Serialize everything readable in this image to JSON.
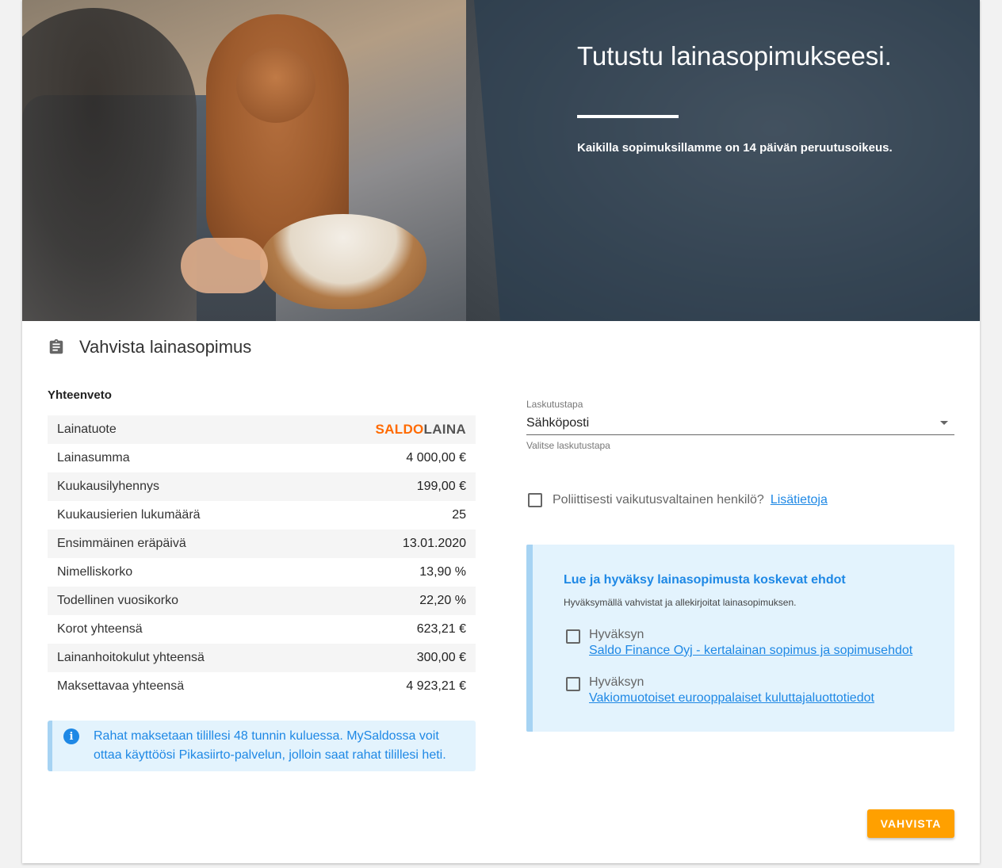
{
  "hero": {
    "title": "Tutustu lainasopimukseesi.",
    "subtitle": "Kaikilla sopimuksillamme on 14 päivän peruutusoikeus."
  },
  "section": {
    "title": "Vahvista lainasopimus",
    "icon": "clipboard-icon"
  },
  "summary": {
    "heading": "Yhteenveto",
    "logo": {
      "part1": "SALDO",
      "part2": "LAINA",
      "color1": "#ff6a00",
      "color2": "#555555"
    },
    "rows": [
      {
        "label": "Lainatuote",
        "value": ""
      },
      {
        "label": "Lainasumma",
        "value": "4 000,00 €"
      },
      {
        "label": "Kuukausilyhennys",
        "value": "199,00 €"
      },
      {
        "label": "Kuukausierien lukumäärä",
        "value": "25"
      },
      {
        "label": "Ensimmäinen eräpäivä",
        "value": "13.01.2020"
      },
      {
        "label": "Nimelliskorko",
        "value": "13,90 %"
      },
      {
        "label": "Todellinen vuosikorko",
        "value": "22,20 %"
      },
      {
        "label": "Korot yhteensä",
        "value": "623,21 €"
      },
      {
        "label": "Lainanhoitokulut yhteensä",
        "value": "300,00 €"
      },
      {
        "label": "Maksettavaa yhteensä",
        "value": "4 923,21 €"
      }
    ]
  },
  "info": {
    "icon": "info-icon",
    "text": "Rahat maksetaan tilillesi 48 tunnin kuluessa. MySaldossa voit ottaa käyttöösi Pikasiirto-palvelun, jolloin saat rahat tilillesi heti."
  },
  "billing": {
    "label": "Laskutustapa",
    "value": "Sähköposti",
    "helper": "Valitse laskutustapa"
  },
  "pep": {
    "question": "Poliittisesti vaikutusvaltainen henkilö?",
    "link": "Lisätietoja",
    "checked": false
  },
  "terms": {
    "title": "Lue ja hyväksy lainasopimusta koskevat ehdot",
    "subtitle": "Hyväksymällä vahvistat ja allekirjoitat lainasopimuksen.",
    "items": [
      {
        "accept": "Hyväksyn",
        "link": "Saldo Finance Oyj - kertalainan sopimus ja sopimusehdot",
        "checked": false
      },
      {
        "accept": "Hyväksyn",
        "link": "Vakiomuotoiset eurooppalaiset kuluttajaluottotiedot",
        "checked": false
      }
    ]
  },
  "actions": {
    "confirm": "VAHVISTA",
    "accent": "#ffa000"
  }
}
